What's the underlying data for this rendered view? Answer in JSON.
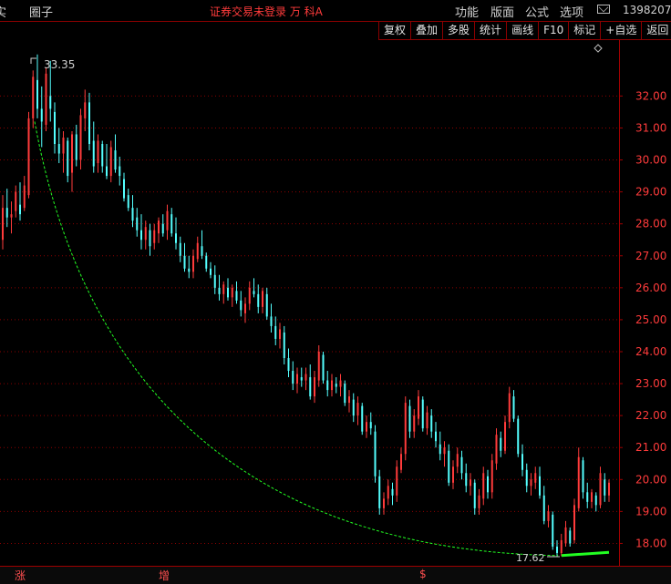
{
  "topbar": {
    "left_fragment": "实",
    "circle_label": "圈子",
    "center_title": "证券交易未登录 万 科A",
    "menu": [
      "功能",
      "版面",
      "公式",
      "选项"
    ],
    "mail_icon": "envelope-icon",
    "phone": "1398207"
  },
  "toolbar": {
    "buttons": [
      "复权",
      "叠加",
      "多股",
      "统计",
      "画线",
      "F10",
      "标记",
      "+自选",
      "返回"
    ]
  },
  "colors": {
    "up": "#ff3b3b",
    "down": "#54ffff",
    "grid": "#8b0000",
    "trendline": "#22ff22"
  },
  "bottombar": {
    "tabs": [
      "涨",
      "增",
      "$"
    ]
  },
  "chart_data": {
    "type": "candlestick",
    "y_ticks": [
      18.0,
      19.0,
      20.0,
      21.0,
      22.0,
      23.0,
      24.0,
      25.0,
      26.0,
      27.0,
      28.0,
      29.0,
      30.0,
      31.0,
      32.0
    ],
    "ylim": [
      17.3,
      33.75
    ],
    "grid": true,
    "high_marker": "33.35",
    "low_marker": "17.62",
    "candles": [
      [
        27.5,
        28.9,
        27.2,
        28.5
      ],
      [
        28.5,
        29.1,
        27.9,
        28.2
      ],
      [
        28.2,
        28.7,
        27.7,
        28.3
      ],
      [
        28.4,
        29.2,
        28.2,
        29.0
      ],
      [
        28.6,
        29.3,
        28.1,
        28.3
      ],
      [
        28.5,
        29.5,
        28.4,
        29.2
      ],
      [
        28.9,
        31.5,
        28.8,
        31.3
      ],
      [
        31.3,
        32.8,
        31.0,
        32.6
      ],
      [
        32.5,
        33.3,
        31.3,
        31.6
      ],
      [
        31.6,
        32.3,
        30.4,
        31.2
      ],
      [
        31.1,
        32.9,
        30.9,
        32.7
      ],
      [
        32.0,
        33.1,
        31.2,
        31.6
      ],
      [
        31.5,
        31.8,
        30.2,
        30.5
      ],
      [
        30.5,
        31.0,
        29.9,
        30.2
      ],
      [
        30.2,
        30.9,
        29.6,
        30.7
      ],
      [
        30.6,
        30.7,
        29.3,
        29.5
      ],
      [
        29.6,
        30.9,
        29.0,
        30.8
      ],
      [
        30.8,
        31.1,
        29.8,
        30.0
      ],
      [
        30.0,
        31.6,
        29.7,
        31.4
      ],
      [
        31.3,
        32.2,
        30.9,
        31.8
      ],
      [
        31.8,
        32.1,
        30.3,
        30.5
      ],
      [
        30.6,
        31.2,
        29.6,
        29.8
      ],
      [
        29.9,
        30.8,
        29.6,
        30.6
      ],
      [
        30.5,
        30.6,
        29.6,
        29.8
      ],
      [
        29.8,
        30.5,
        29.4,
        29.5
      ],
      [
        29.5,
        30.6,
        29.3,
        30.4
      ],
      [
        30.3,
        30.8,
        29.6,
        29.7
      ],
      [
        29.8,
        30.1,
        29.2,
        29.5
      ],
      [
        29.4,
        29.6,
        28.7,
        28.8
      ],
      [
        28.9,
        29.1,
        28.4,
        28.5
      ],
      [
        28.5,
        28.9,
        27.9,
        28.1
      ],
      [
        28.2,
        28.5,
        27.6,
        27.8
      ],
      [
        27.8,
        28.3,
        27.2,
        27.5
      ],
      [
        27.5,
        28.1,
        27.2,
        27.9
      ],
      [
        27.8,
        28.0,
        27.0,
        27.3
      ],
      [
        27.4,
        28.0,
        27.2,
        27.8
      ],
      [
        27.7,
        28.2,
        27.4,
        28.1
      ],
      [
        28.0,
        28.3,
        27.6,
        27.7
      ],
      [
        27.8,
        28.6,
        27.5,
        28.4
      ],
      [
        28.3,
        28.5,
        27.6,
        27.7
      ],
      [
        27.7,
        28.2,
        27.2,
        27.4
      ],
      [
        27.4,
        27.6,
        26.8,
        27.0
      ],
      [
        27.0,
        27.4,
        26.5,
        26.6
      ],
      [
        26.6,
        27.0,
        26.3,
        26.5
      ],
      [
        26.5,
        27.2,
        26.3,
        27.0
      ],
      [
        26.9,
        27.6,
        26.8,
        27.4
      ],
      [
        27.3,
        27.8,
        26.9,
        27.0
      ],
      [
        27.0,
        27.1,
        26.5,
        26.6
      ],
      [
        26.6,
        26.8,
        26.3,
        26.4
      ],
      [
        26.4,
        26.7,
        25.8,
        26.0
      ],
      [
        26.0,
        26.4,
        25.6,
        25.8
      ],
      [
        25.8,
        26.2,
        25.5,
        26.1
      ],
      [
        26.0,
        26.3,
        25.6,
        25.7
      ],
      [
        25.7,
        26.1,
        25.4,
        26.0
      ],
      [
        25.9,
        26.2,
        25.5,
        25.6
      ],
      [
        25.6,
        25.9,
        25.1,
        25.3
      ],
      [
        25.2,
        25.7,
        24.9,
        25.5
      ],
      [
        25.5,
        26.2,
        25.3,
        26.0
      ],
      [
        25.9,
        26.3,
        25.7,
        25.8
      ],
      [
        25.8,
        26.1,
        25.2,
        25.4
      ],
      [
        25.4,
        26.0,
        25.2,
        25.9
      ],
      [
        25.8,
        26.0,
        25.0,
        25.1
      ],
      [
        25.1,
        25.5,
        24.6,
        24.8
      ],
      [
        24.8,
        25.1,
        24.2,
        24.4
      ],
      [
        24.4,
        24.9,
        24.1,
        24.7
      ],
      [
        24.6,
        24.8,
        23.6,
        23.8
      ],
      [
        23.8,
        24.1,
        23.2,
        23.4
      ],
      [
        23.4,
        23.7,
        22.8,
        23.0
      ],
      [
        23.0,
        23.5,
        22.7,
        23.3
      ],
      [
        23.2,
        23.5,
        22.9,
        23.1
      ],
      [
        23.1,
        23.5,
        22.8,
        23.3
      ],
      [
        23.2,
        23.6,
        22.5,
        22.6
      ],
      [
        22.6,
        23.4,
        22.4,
        23.2
      ],
      [
        23.1,
        24.2,
        22.9,
        24.0
      ],
      [
        23.9,
        24.0,
        23.0,
        23.1
      ],
      [
        23.1,
        23.4,
        22.6,
        22.8
      ],
      [
        22.8,
        23.3,
        22.6,
        23.1
      ],
      [
        23.0,
        23.2,
        22.7,
        22.9
      ],
      [
        22.9,
        23.3,
        22.6,
        23.1
      ],
      [
        23.0,
        23.1,
        22.3,
        22.4
      ],
      [
        22.4,
        22.8,
        22.1,
        22.6
      ],
      [
        22.5,
        22.7,
        21.8,
        22.0
      ],
      [
        22.0,
        22.6,
        21.7,
        22.4
      ],
      [
        22.3,
        22.4,
        21.4,
        21.5
      ],
      [
        21.5,
        22.0,
        21.3,
        21.8
      ],
      [
        21.8,
        22.1,
        21.4,
        21.6
      ],
      [
        21.5,
        21.7,
        19.9,
        20.1
      ],
      [
        20.1,
        20.3,
        18.9,
        19.1
      ],
      [
        19.1,
        19.6,
        18.9,
        19.4
      ],
      [
        19.4,
        20.0,
        19.2,
        19.8
      ],
      [
        19.7,
        19.9,
        19.2,
        19.5
      ],
      [
        19.5,
        20.6,
        19.3,
        20.4
      ],
      [
        20.3,
        21.0,
        20.2,
        20.8
      ],
      [
        20.8,
        22.6,
        20.6,
        22.4
      ],
      [
        22.3,
        22.5,
        21.3,
        21.5
      ],
      [
        21.5,
        22.2,
        21.3,
        22.0
      ],
      [
        21.9,
        22.8,
        21.7,
        22.6
      ],
      [
        22.5,
        22.6,
        21.5,
        21.6
      ],
      [
        21.6,
        22.3,
        21.4,
        22.1
      ],
      [
        22.0,
        22.2,
        21.3,
        21.5
      ],
      [
        21.5,
        21.8,
        21.0,
        21.2
      ],
      [
        21.1,
        21.5,
        20.6,
        20.8
      ],
      [
        20.8,
        21.2,
        20.4,
        21.0
      ],
      [
        20.9,
        21.1,
        19.8,
        19.9
      ],
      [
        19.9,
        20.6,
        19.7,
        20.4
      ],
      [
        20.4,
        21.0,
        20.2,
        20.8
      ],
      [
        20.7,
        20.9,
        20.0,
        20.2
      ],
      [
        20.2,
        20.5,
        19.6,
        19.8
      ],
      [
        19.8,
        20.2,
        19.5,
        20.0
      ],
      [
        19.9,
        20.0,
        18.9,
        19.1
      ],
      [
        19.1,
        19.7,
        18.9,
        19.5
      ],
      [
        19.4,
        20.4,
        19.2,
        20.2
      ],
      [
        20.1,
        20.3,
        19.4,
        19.6
      ],
      [
        19.6,
        20.8,
        19.4,
        20.6
      ],
      [
        20.5,
        21.6,
        20.3,
        21.4
      ],
      [
        21.3,
        21.5,
        20.7,
        20.9
      ],
      [
        20.9,
        22.0,
        20.8,
        21.8
      ],
      [
        21.8,
        22.9,
        21.6,
        22.7
      ],
      [
        22.6,
        22.8,
        21.8,
        21.9
      ],
      [
        21.9,
        22.0,
        20.7,
        20.8
      ],
      [
        20.8,
        21.1,
        20.1,
        20.3
      ],
      [
        20.3,
        20.5,
        19.6,
        19.8
      ],
      [
        19.8,
        20.2,
        19.5,
        20.0
      ],
      [
        19.9,
        20.4,
        19.7,
        20.2
      ],
      [
        20.1,
        20.4,
        19.4,
        19.5
      ],
      [
        19.5,
        19.8,
        18.6,
        18.7
      ],
      [
        18.7,
        19.2,
        18.5,
        19.0
      ],
      [
        18.9,
        19.0,
        17.8,
        17.9
      ],
      [
        17.9,
        18.1,
        17.6,
        17.7
      ],
      [
        17.7,
        18.3,
        17.6,
        18.1
      ],
      [
        18.0,
        18.7,
        17.9,
        18.5
      ],
      [
        18.4,
        18.5,
        17.9,
        18.0
      ],
      [
        18.1,
        19.4,
        18.0,
        19.2
      ],
      [
        19.1,
        21.0,
        19.0,
        20.7
      ],
      [
        20.6,
        20.7,
        19.4,
        19.6
      ],
      [
        19.6,
        19.9,
        19.1,
        19.3
      ],
      [
        19.3,
        19.7,
        19.1,
        19.6
      ],
      [
        19.5,
        19.6,
        19.0,
        19.2
      ],
      [
        19.2,
        20.4,
        19.1,
        20.2
      ],
      [
        20.0,
        20.2,
        19.3,
        19.5
      ],
      [
        19.5,
        20.0,
        19.3,
        19.9
      ]
    ]
  }
}
